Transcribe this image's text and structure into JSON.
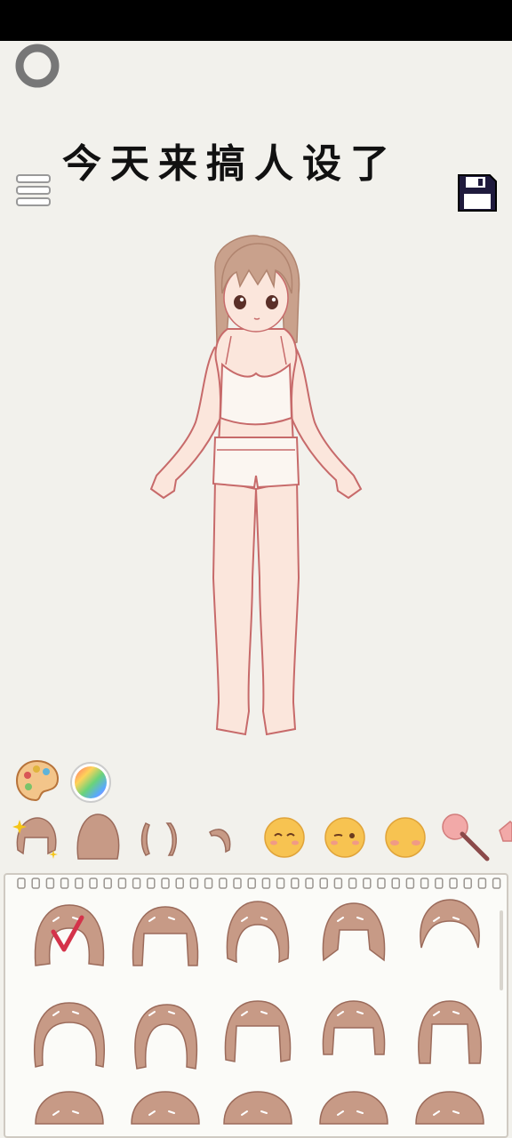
{
  "app": {
    "title": "今天来搞人设了"
  },
  "toolbar": {
    "ring_icon": "ring-icon",
    "menu_icon": "hamburger-menu-icon",
    "save_icon": "floppy-disk-icon"
  },
  "color_tools": {
    "palette_icon": "paint-palette-icon",
    "wheel_icon": "color-wheel-icon"
  },
  "categories": [
    {
      "name": "hairstyle-full-icon",
      "selected": true
    },
    {
      "name": "back-hair-icon"
    },
    {
      "name": "side-hair-icon"
    },
    {
      "name": "ahoge-hair-icon"
    },
    {
      "name": "face-closed-eyes-icon"
    },
    {
      "name": "face-wink-icon"
    },
    {
      "name": "face-blush-icon"
    },
    {
      "name": "makeup-brush-icon"
    },
    {
      "name": "eraser-icon"
    }
  ],
  "hair_grid": {
    "selected_index": 0,
    "colors": {
      "hair": "#c79a86",
      "outline": "#9b6b5b",
      "check": "#d4334a"
    }
  },
  "colors": {
    "background": "#f2f1ec",
    "skin": "#fbe6dc",
    "outline": "#c76a6a",
    "hair": "#c79a86"
  }
}
